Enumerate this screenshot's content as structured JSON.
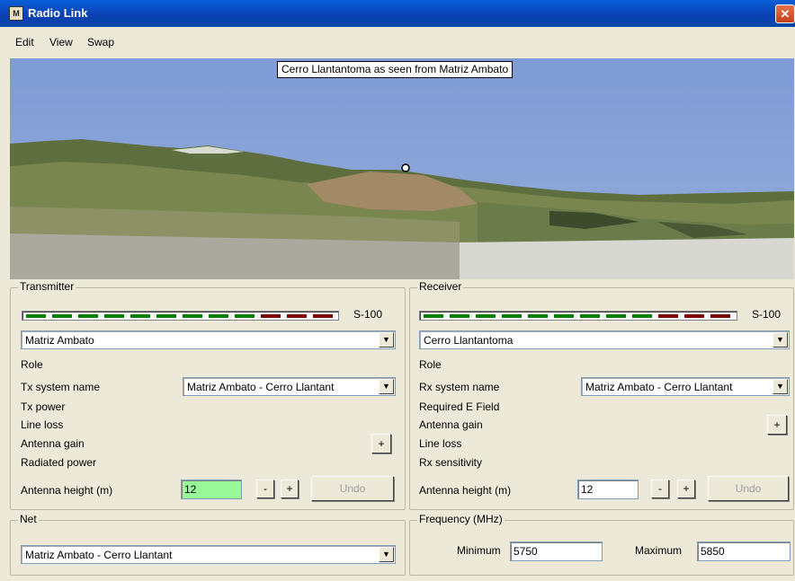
{
  "window": {
    "title": "Radio Link"
  },
  "menu": {
    "items": [
      "Edit",
      "View",
      "Swap"
    ]
  },
  "view": {
    "caption": "Cerro Llantantoma as seen from Matriz Ambato"
  },
  "transmitter": {
    "group_label": "Transmitter",
    "meter_label": "S-100",
    "station": "Matriz Ambato",
    "role_label": "Role",
    "system_name_label": "Tx system name",
    "system_name_value": "Matriz Ambato - Cerro Llantant",
    "power_label": "Tx power",
    "line_loss_label": "Line loss",
    "antenna_gain_label": "Antenna gain",
    "radiated_power_label": "Radiated power",
    "plus_label": "+",
    "antenna_height_label": "Antenna height (m)",
    "antenna_height_value": "12",
    "minus_btn": "-",
    "plus_btn": "+",
    "undo_btn": "Undo"
  },
  "receiver": {
    "group_label": "Receiver",
    "meter_label": "S-100",
    "station": "Cerro Llantantoma",
    "role_label": "Role",
    "system_name_label": "Rx system name",
    "system_name_value": "Matriz Ambato - Cerro Llantant",
    "required_field_label": "Required E Field",
    "antenna_gain_label": "Antenna gain",
    "line_loss_label": "Line loss",
    "sensitivity_label": "Rx sensitivity",
    "plus_label": "+",
    "antenna_height_label": "Antenna height (m)",
    "antenna_height_value": "12",
    "minus_btn": "-",
    "plus_btn": "+",
    "undo_btn": "Undo"
  },
  "net": {
    "group_label": "Net",
    "value": "Matriz Ambato - Cerro Llantant"
  },
  "frequency": {
    "group_label": "Frequency (MHz)",
    "minimum_label": "Minimum",
    "minimum_value": "5750",
    "maximum_label": "Maximum",
    "maximum_value": "5850"
  },
  "meter_colors": {
    "green": "#008000",
    "red": "#800000"
  },
  "signal_segments": {
    "total": 12,
    "green": 9
  },
  "icons": {
    "close": "close-icon",
    "dropdown": "chevron-down-icon",
    "app": "radio-link-icon"
  }
}
